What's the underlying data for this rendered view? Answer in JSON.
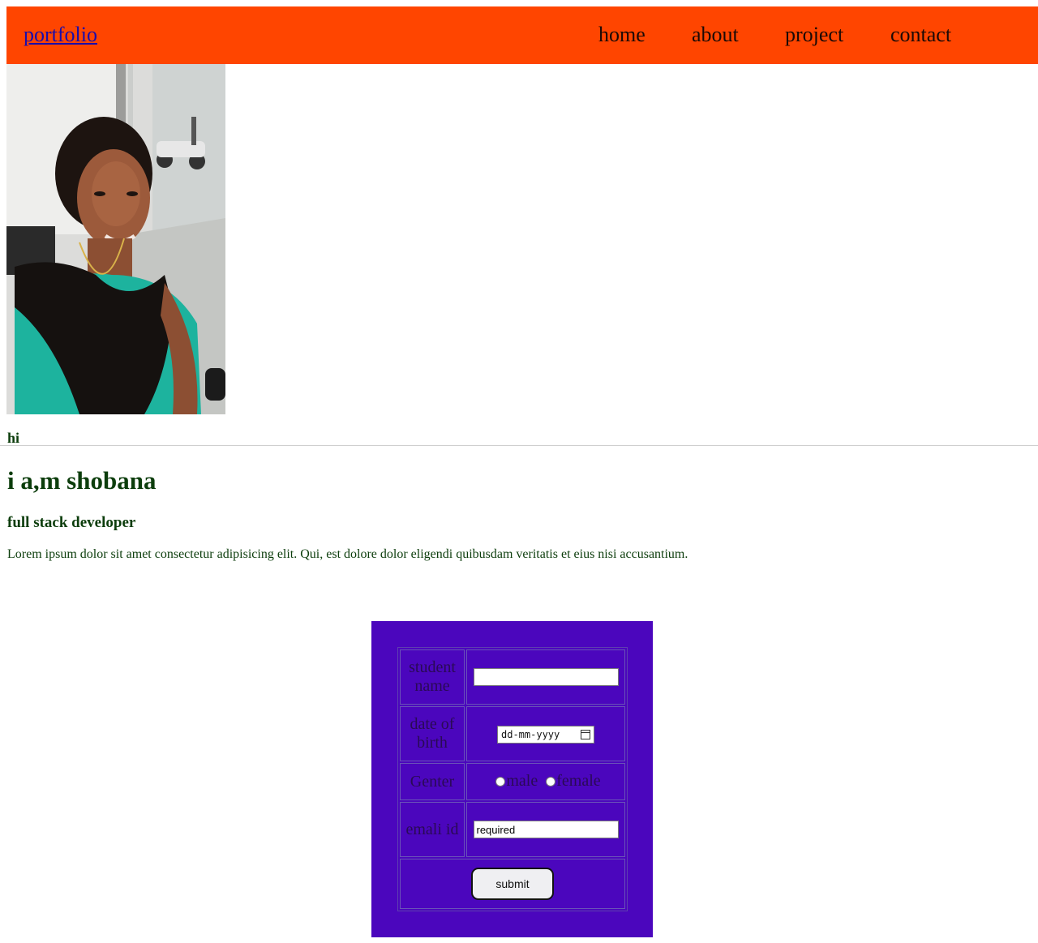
{
  "nav": {
    "brand": "portfolio",
    "links": [
      "home",
      "about",
      "project",
      "contact"
    ],
    "background": "#ff4500"
  },
  "profile": {
    "photo_alt": "profile photo",
    "greeting": "hi",
    "name": "i a,m shobana",
    "role": "full stack developer",
    "description": "Lorem ipsum dolor sit amet consectetur adipisicing elit. Qui, est dolore dolor eligendi quibusdam veritatis et eius nisi accusantium."
  },
  "form": {
    "background": "#4b06bd",
    "student_name_label": "student name",
    "student_name_value": "",
    "dob_label": "date of birth",
    "dob_placeholder": "dd-mm-yyyy",
    "gender_label": "Genter",
    "gender_options": [
      "male",
      "female"
    ],
    "email_label": "emali id",
    "email_value": "required",
    "submit_label": "submit"
  }
}
